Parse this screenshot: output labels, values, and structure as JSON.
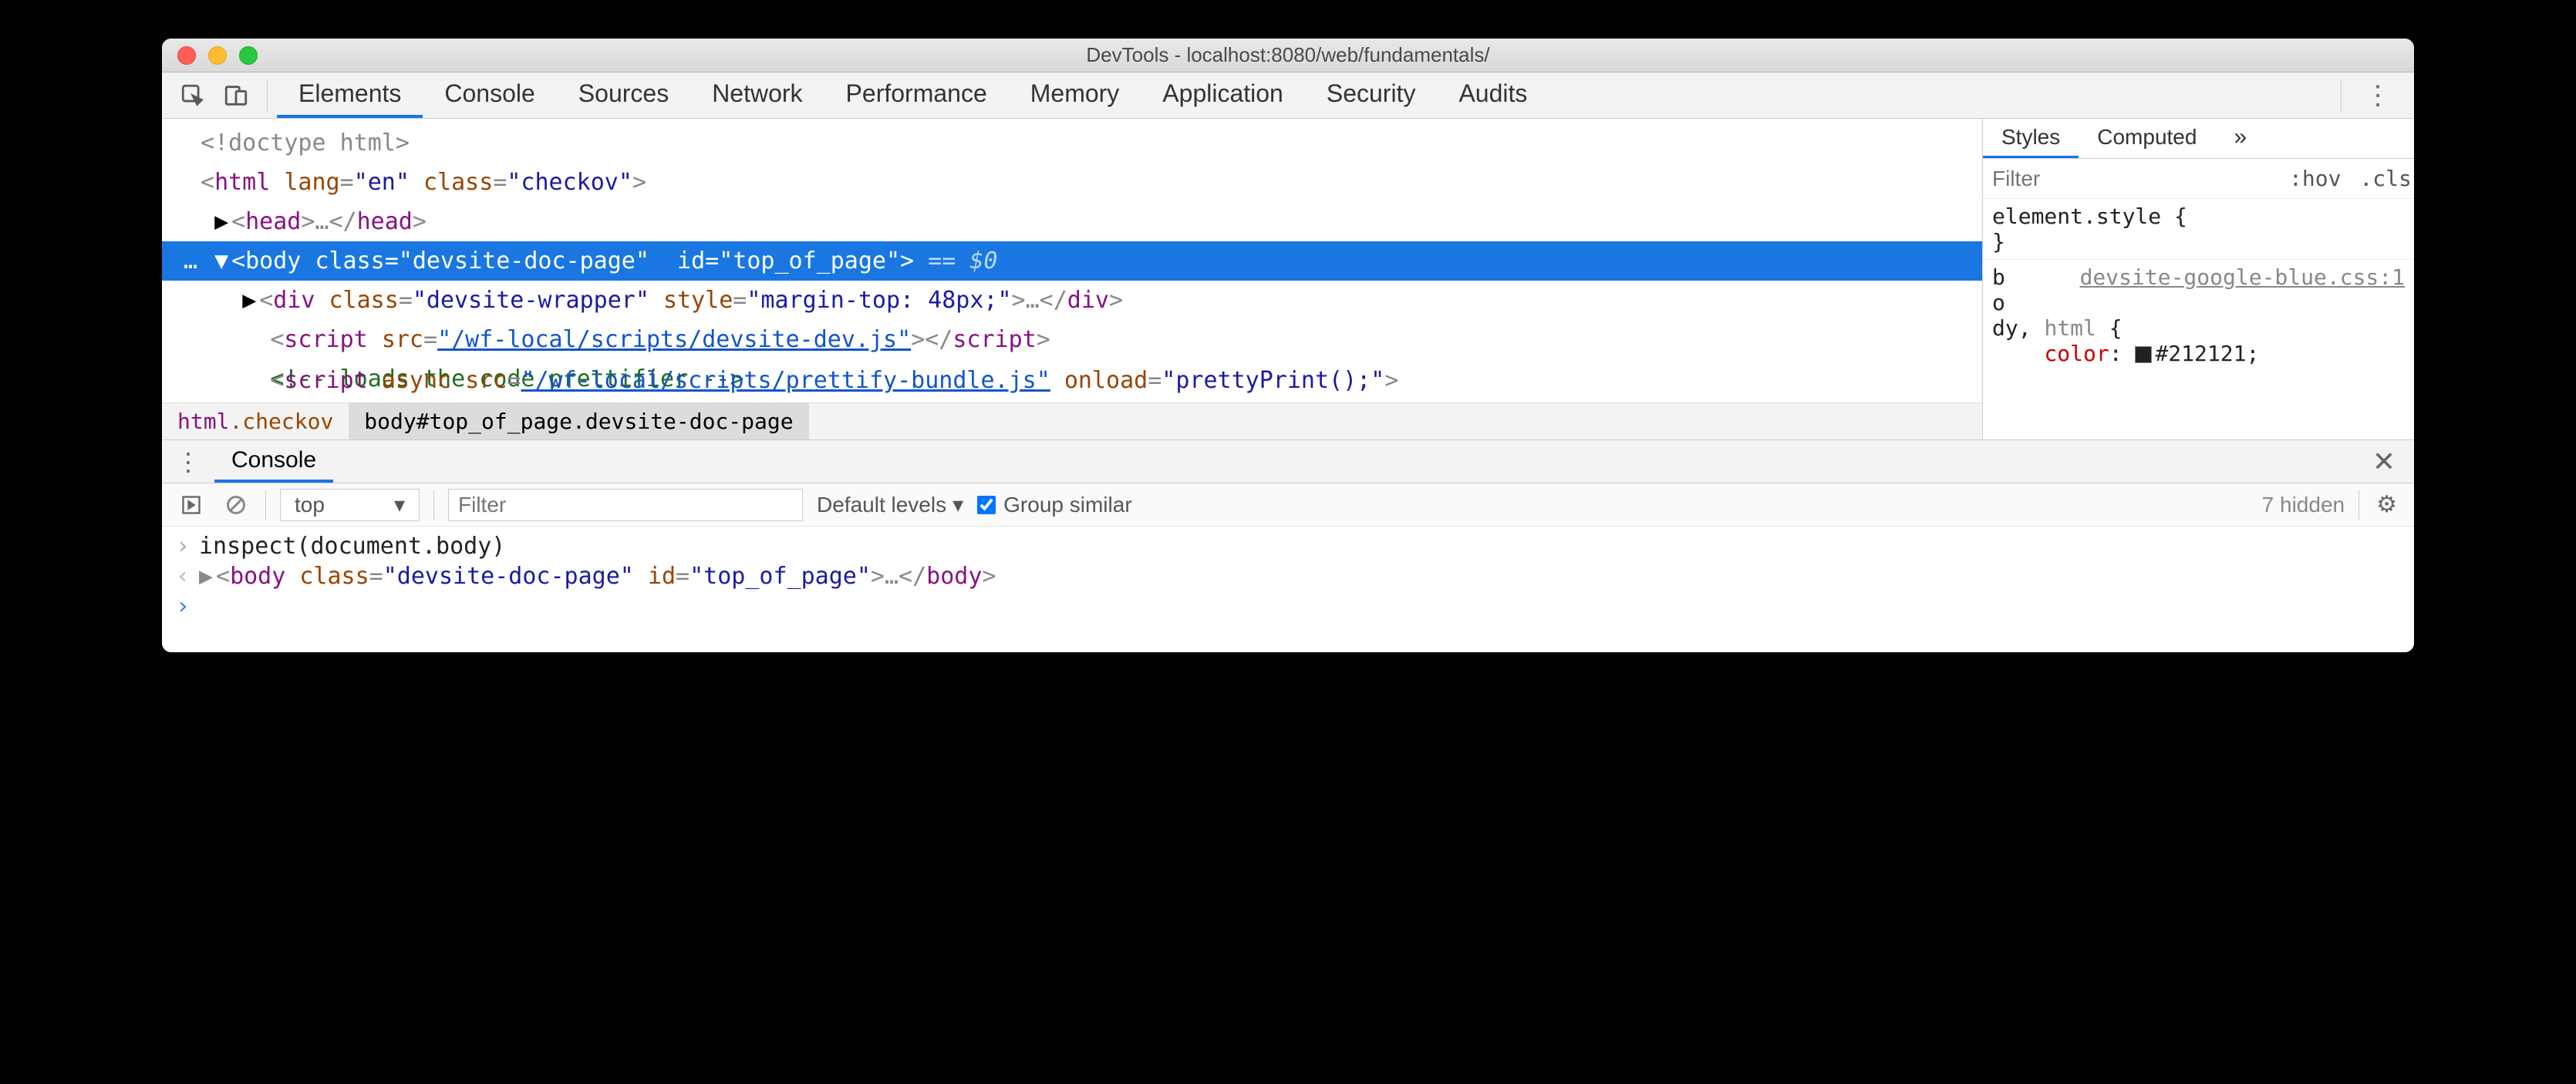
{
  "window": {
    "title": "DevTools - localhost:8080/web/fundamentals/"
  },
  "tabs": [
    "Elements",
    "Console",
    "Sources",
    "Network",
    "Performance",
    "Memory",
    "Application",
    "Security",
    "Audits"
  ],
  "active_tab": "Elements",
  "dom": {
    "l0": "<!doctype html>",
    "l1": {
      "open": "<",
      "tag": "html",
      "a1n": "lang",
      "a1v": "\"en\"",
      "a2n": "class",
      "a2v": "\"checkov\"",
      "close": ">"
    },
    "l2": {
      "open": "<",
      "tag": "head",
      "mid": ">…</",
      "tag2": "head",
      "close": ">"
    },
    "l3": {
      "pre": "…",
      "open": "<",
      "tag": "body",
      "sp": " ",
      "a1n": "class",
      "a1v": "\"devsite-doc-page\"",
      "a2n": "id",
      "a2v": "\"top_of_page\"",
      "close": ">",
      "eq": " == ",
      "dollar": "$0"
    },
    "l4": {
      "open": "<",
      "tag": "div",
      "a1n": "class",
      "a1v": "\"devsite-wrapper\"",
      "a2n": "style",
      "a2v": "\"margin-top: 48px;\"",
      "close": ">…</",
      "tag2": "div",
      "close2": ">"
    },
    "l5": {
      "open": "<",
      "tag": "script",
      "a1n": "src",
      "a1v": "\"/wf-local/scripts/devsite-dev.js\"",
      "close": "></",
      "tag2": "script",
      "close2": ">"
    },
    "l6": "<!-- loads the code prettifier -->",
    "l7": {
      "open": "<",
      "tag": "script",
      "a1n": "async",
      "a2n": "src",
      "a2v": "\"/wf-local/scripts/prettify-bundle.js\"",
      "a3n": "onload",
      "a3v": "\"prettyPrint();\"",
      "close": ">"
    }
  },
  "breadcrumb": {
    "c1_tag": "html",
    "c1_cls": ".checkov",
    "c2": "body#top_of_page.devsite-doc-page"
  },
  "styles": {
    "tabs": [
      "Styles",
      "Computed"
    ],
    "active": "Styles",
    "more": "»",
    "filter_placeholder": "Filter",
    "hov": ":hov",
    "cls": ".cls",
    "plus": "＋",
    "l1": "element.style {",
    "l2": "}",
    "srcfile": "devsite-google-blue.css:1",
    "sel": "body, html {",
    "sel_b": "b",
    "sel_o": "o",
    "sel_dy": "dy",
    "prop": "color",
    "val": "#212121",
    "semi": ";"
  },
  "drawer": {
    "tab": "Console",
    "context": "top",
    "filter_placeholder": "Filter",
    "levels": "Default levels",
    "group": "Group similar",
    "hidden": "7 hidden",
    "line1": "inspect(document.body)",
    "line2": {
      "open": "<",
      "tag": "body",
      "a1n": "class",
      "a1v": "\"devsite-doc-page\"",
      "a2n": "id",
      "a2v": "\"top_of_page\"",
      "close": ">…</",
      "tag2": "body",
      "close2": ">"
    }
  }
}
